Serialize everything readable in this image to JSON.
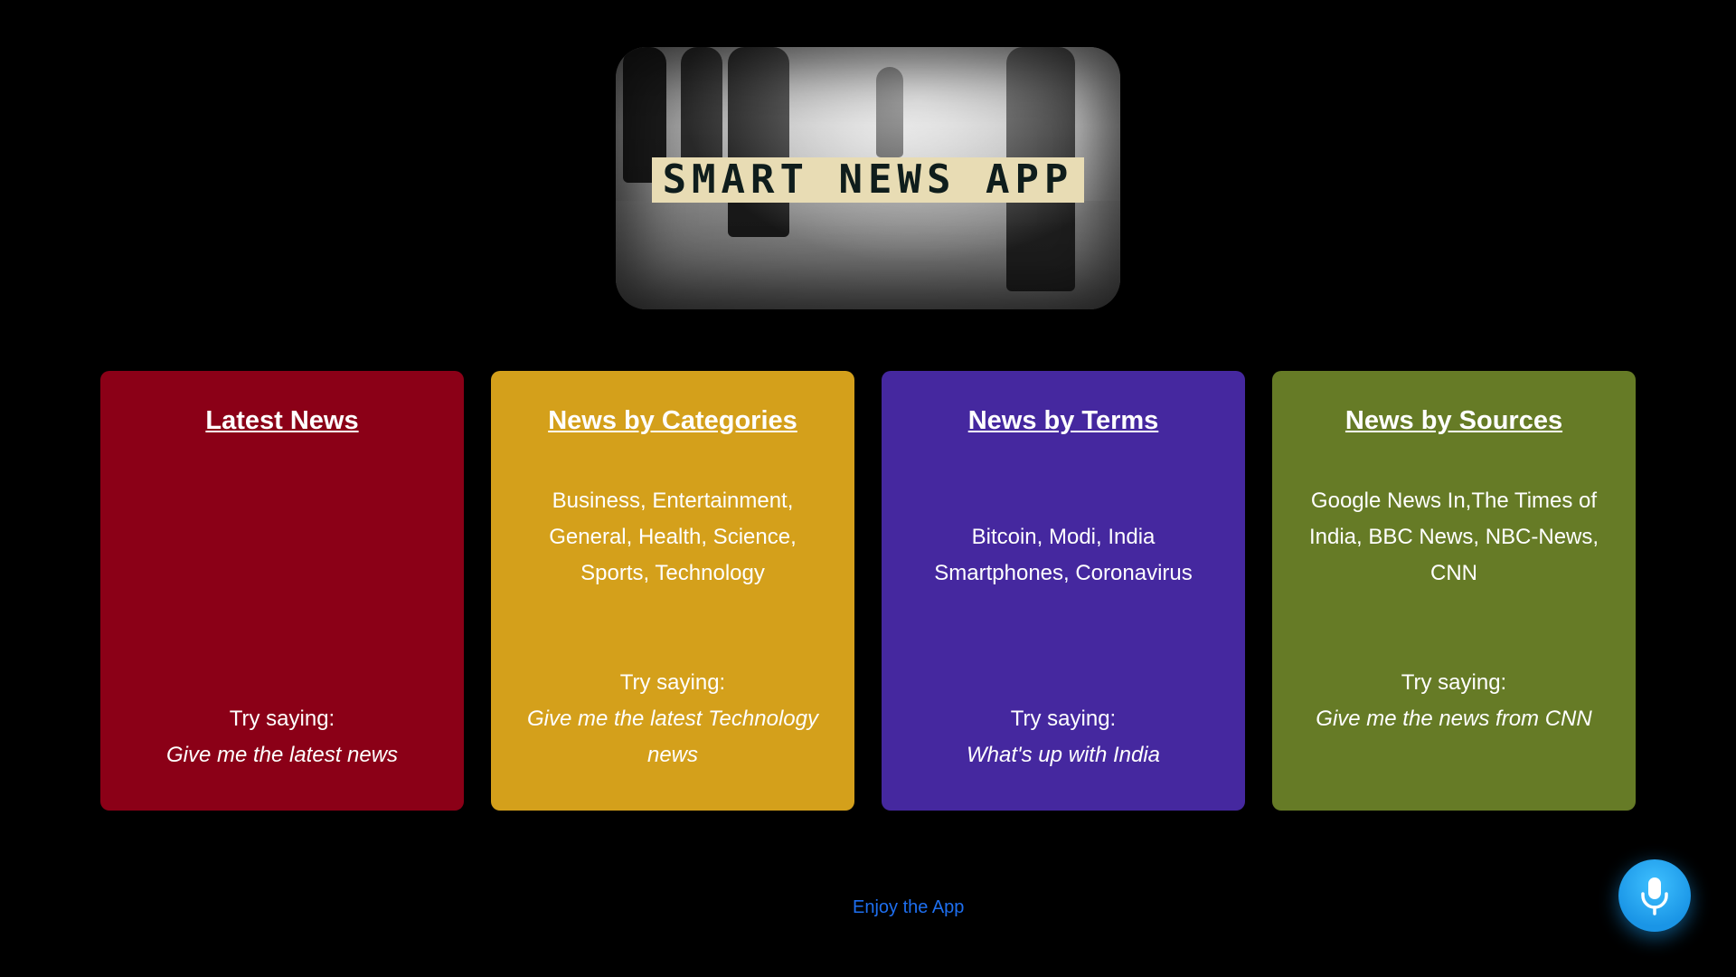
{
  "hero": {
    "title": "SMART NEWS APP"
  },
  "cards": [
    {
      "title": "Latest News",
      "body": "",
      "try_label": "Try saying:",
      "try_example": "Give me the latest news",
      "color": "#8b0017"
    },
    {
      "title": "News by Categories",
      "body": "Business, Entertainment, General, Health, Science, Sports, Technology",
      "try_label": "Try saying:",
      "try_example": "Give me the latest Technology news",
      "color": "#d4a01b"
    },
    {
      "title": "News by Terms",
      "body": "Bitcoin, Modi, India Smartphones, Coronavirus",
      "try_label": "Try saying:",
      "try_example": "What's up with India",
      "color": "#45289f"
    },
    {
      "title": "News by Sources",
      "body": "Google News In,The Times of India, BBC News, NBC-News, CNN",
      "try_label": "Try saying:",
      "try_example": "Give me the news from CNN",
      "color": "#667b26"
    }
  ],
  "footer": {
    "text": "Enjoy the App"
  },
  "mic": {
    "icon": "microphone-icon",
    "color": "#1fa2f0"
  }
}
